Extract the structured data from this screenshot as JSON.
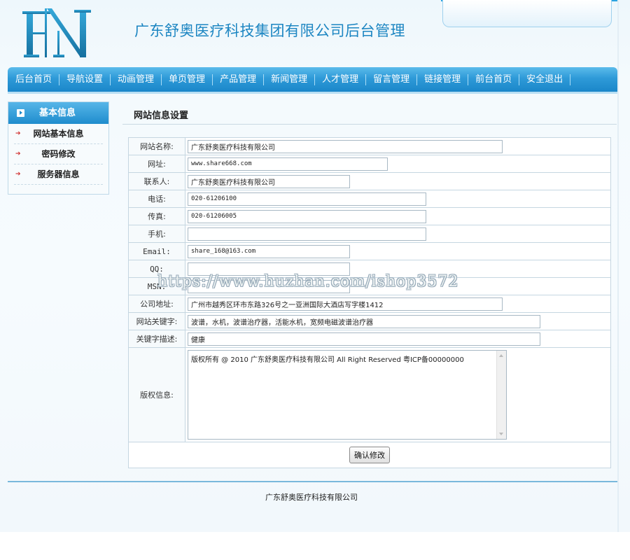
{
  "header": {
    "logo_text": "FN",
    "site_title": "广东舒奥医疗科技集团有限公司后台管理"
  },
  "nav": {
    "items": [
      "后台首页",
      "导航设置",
      "动画管理",
      "单页管理",
      "产品管理",
      "新闻管理",
      "人才管理",
      "留言管理",
      "链接管理",
      "前台首页",
      "安全退出"
    ]
  },
  "sidebar": {
    "title": "基本信息",
    "items": [
      "网站基本信息",
      "密码修改",
      "服务器信息"
    ]
  },
  "main": {
    "title": "网站信息设置",
    "fields": {
      "site_name": {
        "label": "网站名称:",
        "value": "广东舒奥医疗科技有限公司"
      },
      "url": {
        "label": "网址:",
        "value": "www.share668.com"
      },
      "contact": {
        "label": "联系人:",
        "value": "广东舒奥医疗科技有限公司"
      },
      "phone": {
        "label": "电话:",
        "value": "020-61206100"
      },
      "fax": {
        "label": "传真:",
        "value": "020-61206005"
      },
      "mobile": {
        "label": "手机:",
        "value": ""
      },
      "email": {
        "label": "Email:",
        "value": "share_168@163.com"
      },
      "qq": {
        "label": "QQ:",
        "value": ""
      },
      "msn": {
        "label": "MSN:",
        "value": ""
      },
      "address": {
        "label": "公司地址:",
        "value": "广州市越秀区环市东路326号之一亚洲国际大酒店写字楼1412"
      },
      "keywords": {
        "label": "网站关键字:",
        "value": "波谱，水机，波谱治疗器，活能水机，宽频电磁波谱治疗器"
      },
      "description": {
        "label": "关键字描述:",
        "value": "健康"
      },
      "copyright": {
        "label": "版权信息:",
        "value": "版权所有 @ 2010  广东舒奥医疗科技有限公司  All Right Reserved 粤ICP备00000000"
      }
    },
    "submit_label": "确认修改"
  },
  "footer": {
    "text": "广东舒奥医疗科技有限公司"
  },
  "watermark": "https://www.huzhan.com/ishop3572",
  "colors": {
    "nav_blue": "#1a86c9",
    "title_blue": "#1d86c2",
    "bullet_red": "#d03030"
  }
}
